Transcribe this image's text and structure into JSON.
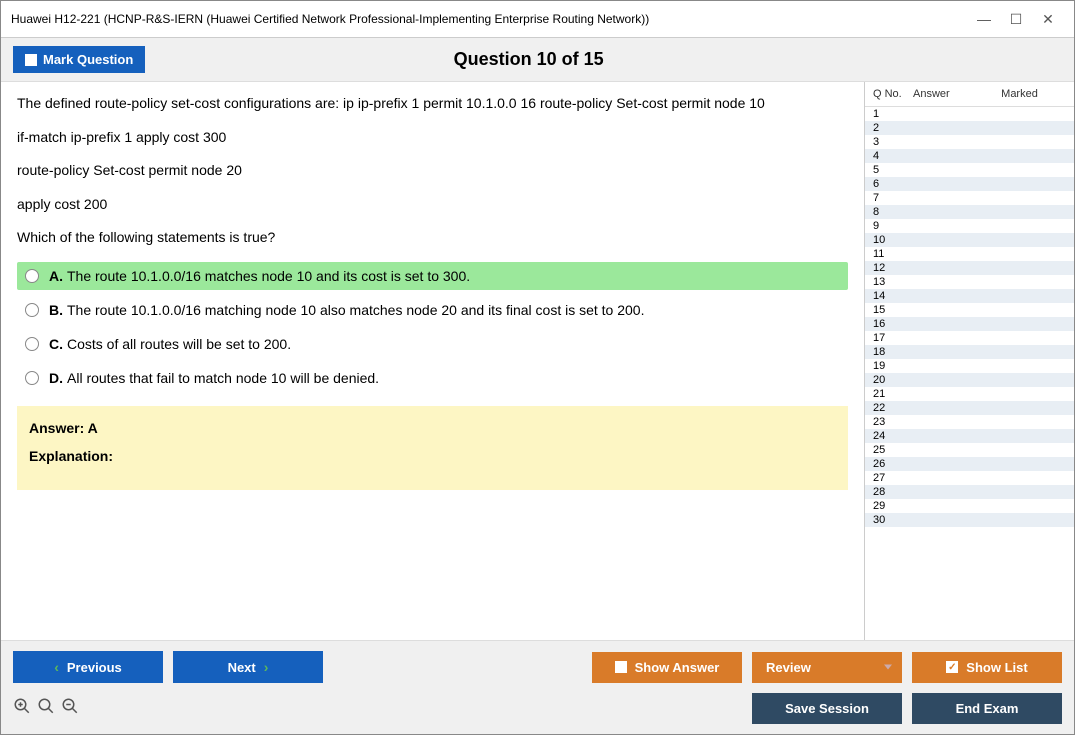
{
  "window": {
    "title": "Huawei H12-221 (HCNP-R&S-IERN (Huawei Certified Network Professional-Implementing Enterprise Routing Network))"
  },
  "header": {
    "mark_label": "Mark Question",
    "counter": "Question 10 of 15"
  },
  "question": {
    "lines": [
      "The defined route-policy set-cost configurations are: ip ip-prefix 1 permit 10.1.0.0 16 route-policy Set-cost permit node 10",
      "if-match ip-prefix 1 apply cost 300",
      "route-policy Set-cost permit node 20",
      "apply cost 200",
      "Which of the following statements is true?"
    ],
    "options": [
      {
        "letter": "A.",
        "text": "The route 10.1.0.0/16 matches node 10 and its cost is set to 300.",
        "correct": true
      },
      {
        "letter": "B.",
        "text": "The route 10.1.0.0/16 matching node 10 also matches node 20 and its final cost is set to 200.",
        "correct": false
      },
      {
        "letter": "C.",
        "text": "Costs of all routes will be set to 200.",
        "correct": false
      },
      {
        "letter": "D.",
        "text": "All routes that fail to match node 10 will be denied.",
        "correct": false
      }
    ],
    "answer_label": "Answer: A",
    "explanation_label": "Explanation:"
  },
  "side": {
    "h1": "Q No.",
    "h2": "Answer",
    "h3": "Marked",
    "rows": [
      1,
      2,
      3,
      4,
      5,
      6,
      7,
      8,
      9,
      10,
      11,
      12,
      13,
      14,
      15,
      16,
      17,
      18,
      19,
      20,
      21,
      22,
      23,
      24,
      25,
      26,
      27,
      28,
      29,
      30
    ]
  },
  "footer": {
    "previous": "Previous",
    "next": "Next",
    "show_answer": "Show Answer",
    "review": "Review",
    "show_list": "Show List",
    "save_session": "Save Session",
    "end_exam": "End Exam"
  }
}
